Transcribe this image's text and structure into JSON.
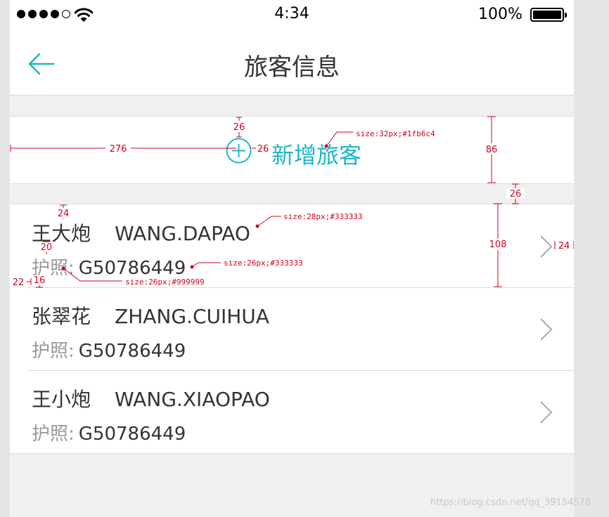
{
  "status_bar": {
    "signal_bars": 5,
    "signal_filled": 4,
    "time": "4:34",
    "battery_text": "100%",
    "battery_level": 1.0
  },
  "nav": {
    "back_icon": "arrow-left-icon",
    "title": "旅客信息"
  },
  "add_passenger": {
    "icon": "plus-circle-icon",
    "label": "新增旅客"
  },
  "passengers": [
    {
      "name_cn": "王大炮",
      "name_py": "WANG.DAPAO",
      "passport_label": "护照:",
      "passport_no": "G50786449"
    },
    {
      "name_cn": "张翠花",
      "name_py": "ZHANG.CUIHUA",
      "passport_label": "护照:",
      "passport_no": "G50786449"
    },
    {
      "name_cn": "王小炮",
      "name_py": "WANG.XIAOPAO",
      "passport_label": "护照:",
      "passport_no": "G50786449"
    }
  ],
  "annotations": {
    "add_plus_size": "26",
    "add_left_margin": "276",
    "add_gap": "26",
    "add_row_height": "86",
    "gap_height": "26",
    "add_font": "size:32px;#1fb6c4",
    "top_padding": "24",
    "line_gap": "20",
    "bottom_padding": "16",
    "left_padding": "22",
    "row_height": "108",
    "right_padding": "24",
    "name_font": "size:28px;#333333",
    "passport_no_font": "size:26px;#333333",
    "passport_label_font": "size:26px;#999999"
  },
  "colors": {
    "accent": "#1fb6c4",
    "text_primary": "#333333",
    "text_secondary": "#999999",
    "annotation": "#d0021b",
    "background": "#f0f0f0"
  },
  "watermark": "https://blog.csdn.net/qq_39154578"
}
